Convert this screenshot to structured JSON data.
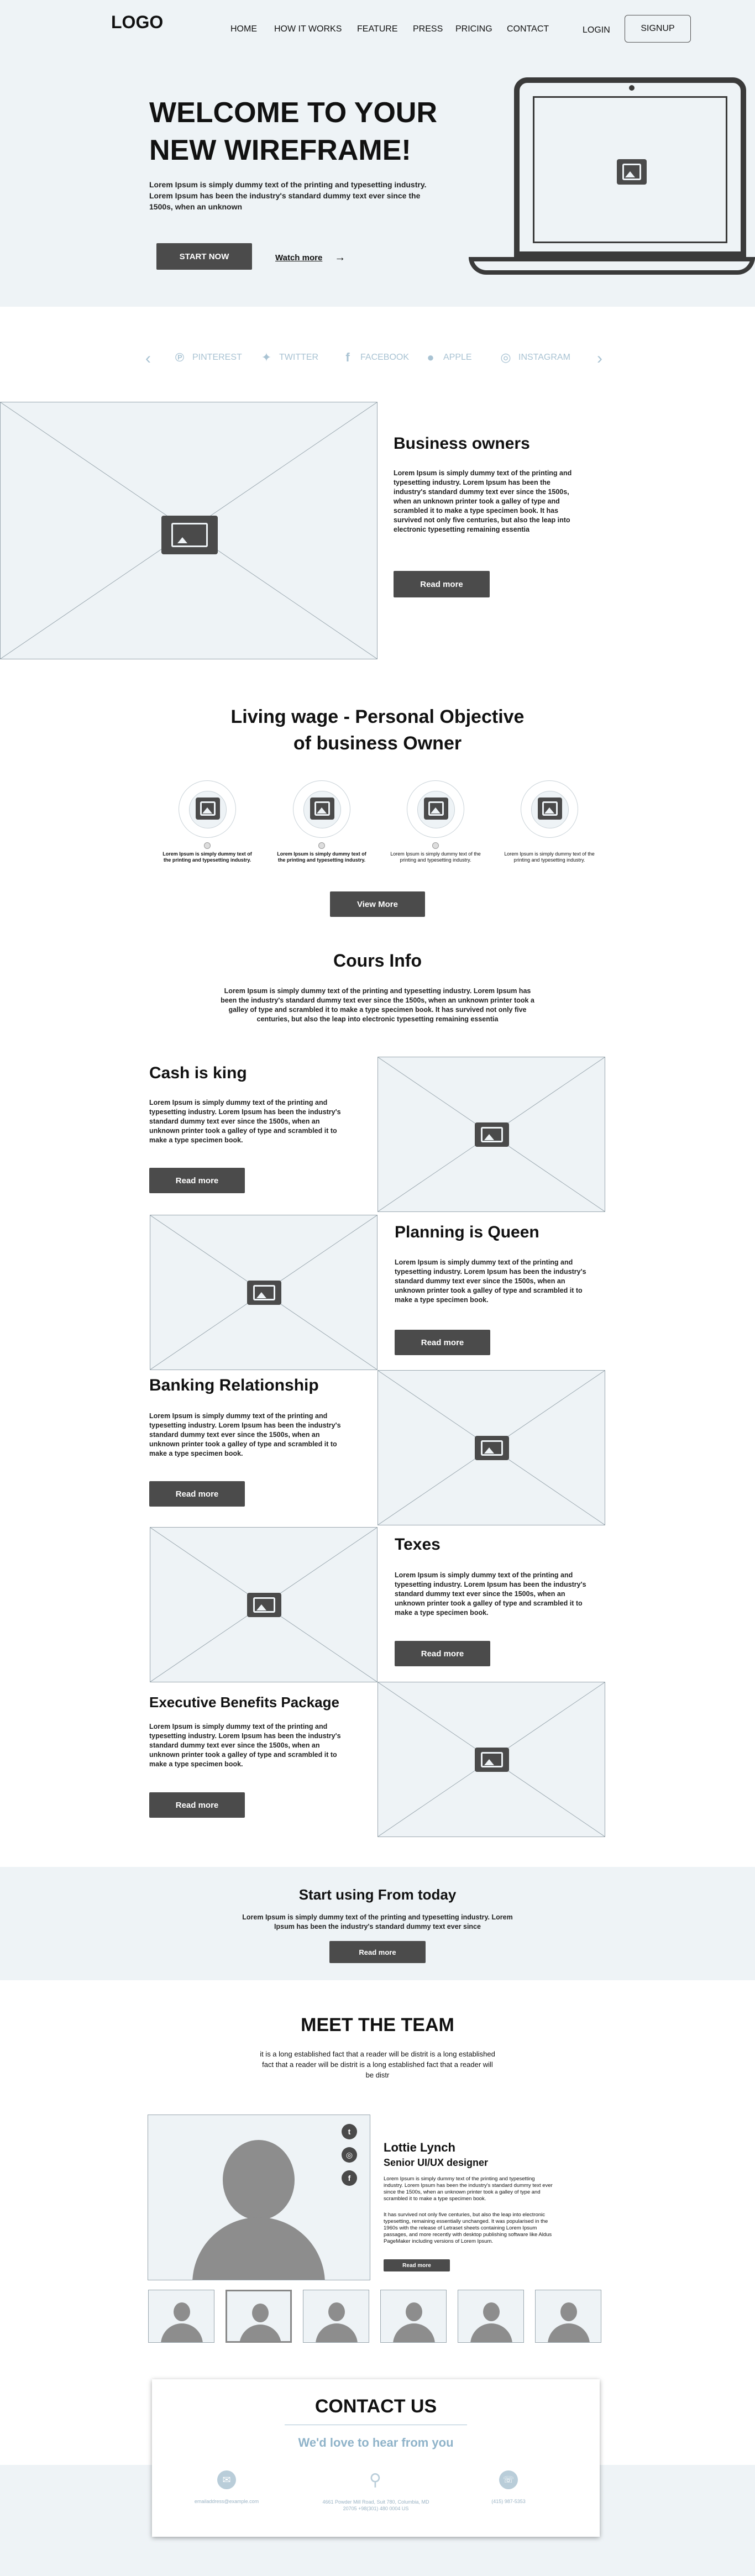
{
  "header": {
    "logo": "LOGO",
    "nav": [
      "HOME",
      "HOW IT WORKS",
      "FEATURE",
      "PRESS",
      "PRICING",
      "CONTACT"
    ],
    "login": "LOGIN",
    "signup": "SIGNUP"
  },
  "hero": {
    "title_line1": "WELCOME TO YOUR",
    "title_line2": "NEW WIREFRAME!",
    "desc": "Lorem Ipsum is simply dummy text of the printing and typesetting industry. Lorem Ipsum has been the industry's standard dummy text ever since the 1500s, when an unknown",
    "start": "START NOW",
    "watch": "Watch more",
    "watch_arrow": "→"
  },
  "socials": {
    "prev": "‹",
    "next": "›",
    "items": [
      "PINTEREST",
      "TWITTER",
      "FACEBOOK",
      "APPLE",
      "INSTAGRAM"
    ]
  },
  "business": {
    "title": "Business owners",
    "desc": "Lorem Ipsum is simply dummy text of the printing and typesetting industry. Lorem Ipsum has been the industry's standard dummy text ever since the 1500s, when an unknown printer took a galley of type and scrambled it to make a type specimen book. It has survived not only five centuries, but also the leap into electronic typesetting remaining essentia",
    "button": "Read more"
  },
  "living": {
    "title_line1": "Living wage - Personal Objective",
    "title_line2": "of business Owner",
    "items": [
      "Lorem Ipsum is simply dummy text of the printing and typesetting industry.",
      "Lorem Ipsum is simply dummy text of the printing and typesetting industry.",
      "Lorem Ipsum is simply dummy text of the printing and typesetting industry.",
      "Lorem Ipsum is simply dummy text of the printing and typesetting industry."
    ],
    "button": "View More"
  },
  "cours": {
    "title": "Cours Info",
    "desc": "Lorem Ipsum is simply dummy text of the printing and typesetting industry. Lorem Ipsum has been the industry's standard dummy text ever since the 1500s, when an unknown printer took a galley of type and scrambled it to make a type specimen book. It has survived not only five centuries, but also the leap into electronic typesetting remaining essentia"
  },
  "features": [
    {
      "title": "Cash is king",
      "desc": "Lorem Ipsum is simply dummy text of the printing and typesetting industry. Lorem Ipsum has been the industry's standard dummy text ever since the 1500s, when an unknown printer took a galley of type and scrambled it to make a type specimen book.",
      "button": "Read more"
    },
    {
      "title": "Planning is Queen",
      "desc": "Lorem Ipsum is simply dummy text of the printing and typesetting industry. Lorem Ipsum has been the industry's standard dummy text ever since the 1500s, when an unknown printer took a galley of type and scrambled it to make a type specimen book.",
      "button": "Read more"
    },
    {
      "title": "Banking Relationship",
      "desc": "Lorem Ipsum is simply dummy text of the printing and typesetting industry. Lorem Ipsum has been the industry's standard dummy text ever since the 1500s, when an unknown printer took a galley of type and scrambled it to make a type specimen book.",
      "button": "Read more"
    },
    {
      "title": "Texes",
      "desc": "Lorem Ipsum is simply dummy text of the printing and typesetting industry. Lorem Ipsum has been the industry's standard dummy text ever since the 1500s, when an unknown printer took a galley of type and scrambled it to make a type specimen book.",
      "button": "Read more"
    },
    {
      "title": "Executive Benefits Package",
      "desc": "Lorem Ipsum is simply dummy text of the printing and typesetting industry. Lorem Ipsum has been the industry's standard dummy text ever since the 1500s, when an unknown printer took a galley of type and scrambled it to make a type specimen book.",
      "button": "Read more"
    }
  ],
  "cta": {
    "title": "Start using From today",
    "desc": "Lorem Ipsum is simply dummy text of the printing and typesetting industry. Lorem Ipsum has been the industry's standard dummy text ever since",
    "button": "Read more"
  },
  "team": {
    "title": "MEET THE TEAM",
    "desc": "it is a long established fact that a reader will be distrit is a long established fact that a reader will be distrit is a long established fact that a reader will be distr",
    "member_name": "Lottie Lynch",
    "member_role": "Senior UI/UX designer",
    "member_desc1": "Lorem Ipsum is simply dummy text of the printing and typesetting industry. Lorem Ipsum has been the industry's standard dummy text ever since the 1500s, when an unknown printer took a galley of type and scrambled it to make a type specimen book.",
    "member_desc2": "It has survived not only five centuries, but also the leap into electronic typesetting, remaining essentially unchanged. It was popularised in the 1960s with the release of Letraset sheets containing Lorem Ipsum passages, and more recently with desktop publishing software like Aldus PageMaker including versions of Lorem Ipsum.",
    "button": "Read more"
  },
  "contact": {
    "title": "CONTACT US",
    "subtitle": "We'd love to hear from you",
    "email": "emailaddress@example.com",
    "address": "4661 Powder Mill Road, Suit 780, Columbia, MD 20705 +98(301) 480 0004 US",
    "phone": "(415) 987-5353"
  },
  "colors": {
    "hero_bg": "#eef3f6",
    "dark_button": "#4b4b4b",
    "social_blue": "#a9c3d3",
    "contact_subtitle": "#8fb3c9"
  }
}
